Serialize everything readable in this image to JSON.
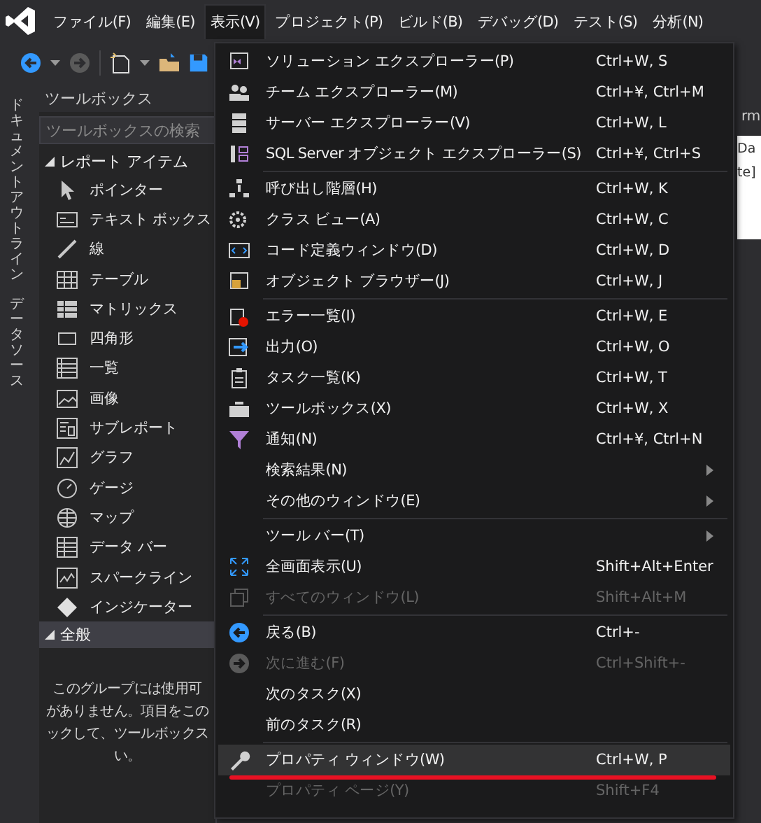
{
  "menu_bar": {
    "items": [
      {
        "label": "ファイル(F)",
        "selected": false
      },
      {
        "label": "編集(E)",
        "selected": false
      },
      {
        "label": "表示(V)",
        "selected": true
      },
      {
        "label": "プロジェクト(P)",
        "selected": false
      },
      {
        "label": "ビルド(B)",
        "selected": false
      },
      {
        "label": "デバッグ(D)",
        "selected": false
      },
      {
        "label": "テスト(S)",
        "selected": false
      },
      {
        "label": "分析(N)",
        "selected": false
      }
    ]
  },
  "side_tabs": [
    "ドキュメントアウトライン",
    "データソース"
  ],
  "toolbox": {
    "title": "ツールボックス",
    "search": {
      "placeholder": "ツールボックスの検索"
    },
    "groups": [
      {
        "label": "レポート アイテム",
        "expanded": true,
        "items": [
          "ポインター",
          "テキスト ボックス",
          "線",
          "テーブル",
          "マトリックス",
          "四角形",
          "一覧",
          "画像",
          "サブレポート",
          "グラフ",
          "ゲージ",
          "マップ",
          "データ バー",
          "スパークライン",
          "インジケーター"
        ]
      },
      {
        "label": "全般",
        "expanded": true,
        "message": [
          "このグループには使用可",
          "がありません。項目をこの",
          "ックして、ツールボックス",
          "い。"
        ]
      }
    ]
  },
  "editor": {
    "tab": "rm",
    "lines": [
      "Da",
      "te]"
    ]
  },
  "view_menu": {
    "items": [
      {
        "kind": "item",
        "label": "ソリューション エクスプローラー(P)",
        "shortcut": "Ctrl+W, S",
        "disabled": false,
        "selected": false,
        "submenu": false
      },
      {
        "kind": "item",
        "label": "チーム エクスプローラー(M)",
        "shortcut": "Ctrl+¥, Ctrl+M",
        "disabled": false,
        "selected": false,
        "submenu": false
      },
      {
        "kind": "item",
        "label": "サーバー エクスプローラー(V)",
        "shortcut": "Ctrl+W, L",
        "disabled": false,
        "selected": false,
        "submenu": false
      },
      {
        "kind": "item",
        "label": "SQL Server オブジェクト エクスプローラー(S)",
        "shortcut": "Ctrl+¥, Ctrl+S",
        "disabled": false,
        "selected": false,
        "submenu": false
      },
      {
        "kind": "separator"
      },
      {
        "kind": "item",
        "label": "呼び出し階層(H)",
        "shortcut": "Ctrl+W, K",
        "disabled": false,
        "selected": false,
        "submenu": false
      },
      {
        "kind": "item",
        "label": "クラス ビュー(A)",
        "shortcut": "Ctrl+W, C",
        "disabled": false,
        "selected": false,
        "submenu": false
      },
      {
        "kind": "item",
        "label": "コード定義ウィンドウ(D)",
        "shortcut": "Ctrl+W, D",
        "disabled": false,
        "selected": false,
        "submenu": false
      },
      {
        "kind": "item",
        "label": "オブジェクト ブラウザー(J)",
        "shortcut": "Ctrl+W, J",
        "disabled": false,
        "selected": false,
        "submenu": false
      },
      {
        "kind": "separator"
      },
      {
        "kind": "item",
        "label": "エラー一覧(I)",
        "shortcut": "Ctrl+W, E",
        "disabled": false,
        "selected": false,
        "submenu": false
      },
      {
        "kind": "item",
        "label": "出力(O)",
        "shortcut": "Ctrl+W, O",
        "disabled": false,
        "selected": false,
        "submenu": false
      },
      {
        "kind": "item",
        "label": "タスク一覧(K)",
        "shortcut": "Ctrl+W, T",
        "disabled": false,
        "selected": false,
        "submenu": false
      },
      {
        "kind": "item",
        "label": "ツールボックス(X)",
        "shortcut": "Ctrl+W, X",
        "disabled": false,
        "selected": false,
        "submenu": false
      },
      {
        "kind": "item",
        "label": "通知(N)",
        "shortcut": "Ctrl+¥, Ctrl+N",
        "disabled": false,
        "selected": false,
        "submenu": false
      },
      {
        "kind": "item",
        "label": "検索結果(N)",
        "disabled": false,
        "selected": false,
        "submenu": true
      },
      {
        "kind": "item",
        "label": "その他のウィンドウ(E)",
        "disabled": false,
        "selected": false,
        "submenu": true
      },
      {
        "kind": "separator"
      },
      {
        "kind": "item",
        "label": "ツール バー(T)",
        "disabled": false,
        "selected": false,
        "submenu": true
      },
      {
        "kind": "item",
        "label": "全画面表示(U)",
        "shortcut": "Shift+Alt+Enter",
        "disabled": false,
        "selected": false,
        "submenu": false
      },
      {
        "kind": "item",
        "label": "すべてのウィンドウ(L)",
        "shortcut": "Shift+Alt+M",
        "disabled": true,
        "selected": false,
        "submenu": false
      },
      {
        "kind": "separator"
      },
      {
        "kind": "item",
        "label": "戻る(B)",
        "shortcut": "Ctrl+-",
        "disabled": false,
        "selected": false,
        "submenu": false
      },
      {
        "kind": "item",
        "label": "次に進む(F)",
        "shortcut": "Ctrl+Shift+-",
        "disabled": true,
        "selected": false,
        "submenu": false
      },
      {
        "kind": "item",
        "label": "次のタスク(X)",
        "disabled": false,
        "selected": false,
        "submenu": false
      },
      {
        "kind": "item",
        "label": "前のタスク(R)",
        "disabled": false,
        "selected": false,
        "submenu": false
      },
      {
        "kind": "separator"
      },
      {
        "kind": "item",
        "label": "プロパティ ウィンドウ(W)",
        "shortcut": "Ctrl+W, P",
        "disabled": false,
        "selected": true,
        "submenu": false,
        "underlined": true
      },
      {
        "kind": "item",
        "label": "プロパティ ページ(Y)",
        "shortcut": "Shift+F4",
        "disabled": true,
        "selected": false,
        "submenu": false
      }
    ]
  }
}
